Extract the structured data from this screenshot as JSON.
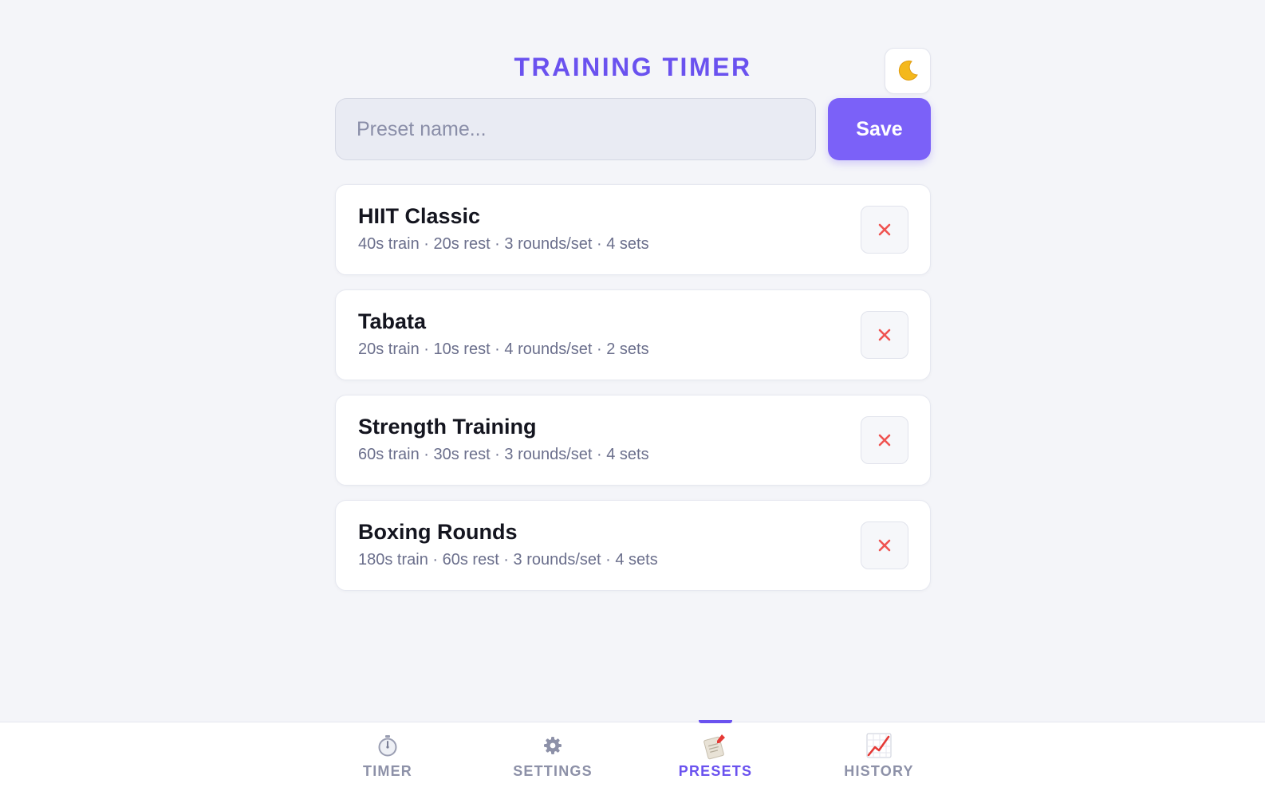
{
  "app": {
    "title": "TRAINING TIMER",
    "theme_toggle_icon": "moon-icon"
  },
  "save_form": {
    "placeholder": "Preset name...",
    "value": "",
    "save_label": "Save"
  },
  "presets": [
    {
      "name": "HIIT Classic",
      "details": "40s train · 20s rest · 3 rounds/set · 4 sets"
    },
    {
      "name": "Tabata",
      "details": "20s train · 10s rest · 4 rounds/set · 2 sets"
    },
    {
      "name": "Strength Training",
      "details": "60s train · 30s rest · 3 rounds/set · 4 sets"
    },
    {
      "name": "Boxing Rounds",
      "details": "180s train · 60s rest · 3 rounds/set · 4 sets"
    }
  ],
  "nav": {
    "tabs": [
      {
        "label": "TIMER",
        "icon": "stopwatch-icon",
        "active": false
      },
      {
        "label": "SETTINGS",
        "icon": "gear-icon",
        "active": false
      },
      {
        "label": "PRESETS",
        "icon": "bookmark-tabs-icon",
        "active": true
      },
      {
        "label": "HISTORY",
        "icon": "chart-increasing-icon",
        "active": false
      }
    ]
  },
  "colors": {
    "accent": "#6a52ef",
    "save_button": "#7b61f8",
    "delete_icon": "#ef5350",
    "background": "#f4f5f9"
  }
}
